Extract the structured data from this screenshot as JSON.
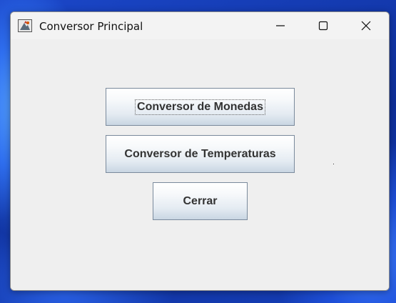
{
  "window": {
    "title": "Conversor Principal",
    "icons": {
      "app": "java-app-icon",
      "minimize": "minimize-icon",
      "maximize": "maximize-icon",
      "close": "close-icon"
    }
  },
  "buttons": {
    "monedas_label": "Conversor de Monedas",
    "temperaturas_label": "Conversor de Temperaturas",
    "cerrar_label": "Cerrar"
  },
  "colors": {
    "window_bg": "#efefef",
    "button_text": "#333333",
    "button_border": "#7a8a9c"
  }
}
